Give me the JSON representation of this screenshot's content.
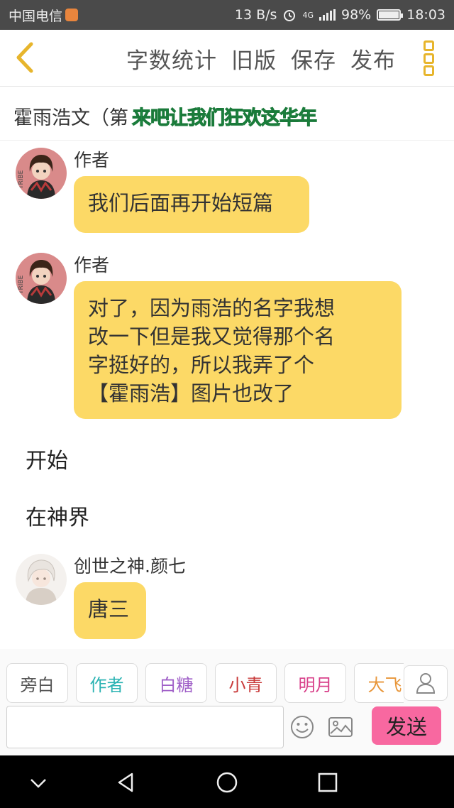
{
  "status_bar": {
    "carrier": "中国电信",
    "speed": "13 B/s",
    "network": "4G",
    "battery": "98%",
    "battery_level": 0.98,
    "time": "18:03"
  },
  "toolbar": {
    "actions": [
      "字数统计",
      "旧版",
      "保存",
      "发布"
    ],
    "accent_color": "#e7b52c"
  },
  "document": {
    "title": "霍雨浩文（第",
    "overlay_text": "来吧让我们狂欢这华年"
  },
  "messages": [
    {
      "type": "bubble",
      "speaker": "作者",
      "avatar": "anime-girl-avatar",
      "text": "我们后面再开始短篇"
    },
    {
      "type": "bubble",
      "speaker": "作者",
      "avatar": "anime-girl-avatar",
      "lines": [
        "对了，因为雨浩的名字我想",
        "改一下但是我又觉得那个名",
        "字挺好的，所以我弄了个",
        "【霍雨浩】图片也改了"
      ]
    },
    {
      "type": "narration",
      "text": "开始"
    },
    {
      "type": "narration",
      "text": "在神界"
    },
    {
      "type": "bubble",
      "speaker": "创世之神.颜七",
      "avatar": "white-hair-boy-avatar",
      "text": "唐三"
    }
  ],
  "bubble_color": "#fcd966",
  "roles": [
    {
      "label": "旁白",
      "color": "#555555"
    },
    {
      "label": "作者",
      "color": "#2bb3b3"
    },
    {
      "label": "白糖",
      "color": "#a060c8"
    },
    {
      "label": "小青",
      "color": "#c83838"
    },
    {
      "label": "明月",
      "color": "#d8408a"
    },
    {
      "label": "大飞",
      "color": "#e8963a"
    }
  ],
  "composer": {
    "input_value": "",
    "send_label": "发送",
    "send_color": "#f868a0"
  },
  "icons": {
    "back": "chevron-left-icon",
    "more": "more-vertical-icon",
    "person": "person-icon",
    "emoji": "emoji-icon",
    "image": "image-icon",
    "nav_down": "chevron-down-icon",
    "nav_back": "triangle-back-icon",
    "nav_home": "circle-home-icon",
    "nav_recent": "square-recent-icon"
  }
}
